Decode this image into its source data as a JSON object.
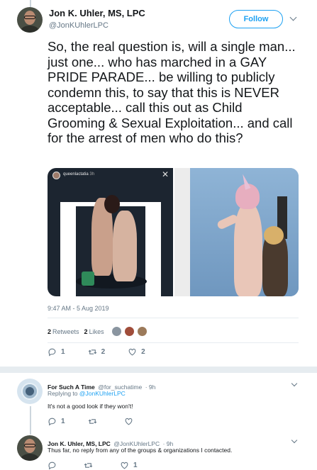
{
  "main_tweet": {
    "author_name": "Jon K. Uhler, MS, LPC",
    "author_handle": "@JonKUhlerLPC",
    "follow_label": "Follow",
    "text": "So, the real question is, will a single man... just one... who has marched in a GAY PRIDE PARADE...  be willing to publicly condemn this, to say that this is NEVER acceptable... call this out as Child Grooming & Sexual Exploitation... and call for the arrest of men who do this?",
    "media_left": {
      "story_user": "queenlactatia",
      "story_time": "3h"
    },
    "timestamp": "9:47 AM - 5 Aug 2019",
    "retweets_count": "2",
    "retweets_label": "Retweets",
    "likes_count": "2",
    "likes_label": "Likes",
    "actions": {
      "replies": "1",
      "retweets": "2",
      "likes": "2"
    }
  },
  "replies": [
    {
      "author_name": "For Such A Time",
      "author_handle": "@for_suchatime",
      "time": "· 9h",
      "replying_to_prefix": "Replying to",
      "replying_to_handle": "@JonKUhlerLPC",
      "text": "It's not a good look if they won't!",
      "actions": {
        "replies": "1",
        "retweets": "",
        "likes": ""
      }
    },
    {
      "author_name": "Jon K. Uhler, MS, LPC",
      "author_handle": "@JonKUhlerLPC",
      "time": "· 9h",
      "text": "Thus far, no reply from any of the groups & organizations I contacted.",
      "actions": {
        "replies": "",
        "retweets": "",
        "likes": "1"
      }
    }
  ],
  "colors": {
    "accent": "#1da1f2",
    "secondary_text": "#657786",
    "divider": "#e6ecf0"
  }
}
